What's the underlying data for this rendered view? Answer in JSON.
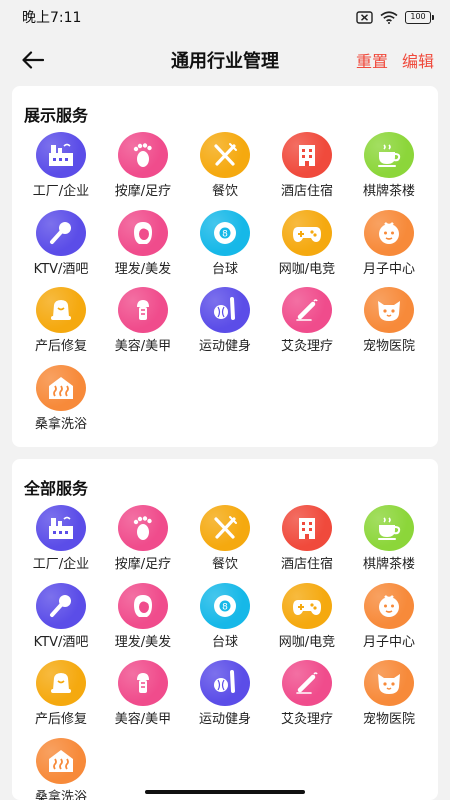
{
  "status_bar": {
    "time": "晚上7:11",
    "battery": "100"
  },
  "header": {
    "title": "通用行业管理",
    "reset_label": "重置",
    "edit_label": "编辑"
  },
  "sections": [
    {
      "title": "展示服务",
      "items": [
        {
          "label": "工厂/企业",
          "icon": "factory-icon",
          "color": "#5b4de8"
        },
        {
          "label": "按摩/足疗",
          "icon": "footprint-icon",
          "color": "#f04c8c"
        },
        {
          "label": "餐饮",
          "icon": "fork-knife-icon",
          "color": "#f5a90f"
        },
        {
          "label": "酒店住宿",
          "icon": "hotel-icon",
          "color": "#f04a3c"
        },
        {
          "label": "棋牌茶楼",
          "icon": "teacup-icon",
          "color": "#8cd63a"
        },
        {
          "label": "KTV/酒吧",
          "icon": "microphone-icon",
          "color": "#5b4de8"
        },
        {
          "label": "理发/美发",
          "icon": "hair-icon",
          "color": "#f04c8c"
        },
        {
          "label": "台球",
          "icon": "billiard-ball-icon",
          "color": "#16b8e8"
        },
        {
          "label": "网咖/电竞",
          "icon": "gamepad-icon",
          "color": "#f5a90f"
        },
        {
          "label": "月子中心",
          "icon": "baby-icon",
          "color": "#f78a3a"
        },
        {
          "label": "产后修复",
          "icon": "hat-icon",
          "color": "#f5a90f"
        },
        {
          "label": "美容/美甲",
          "icon": "nail-icon",
          "color": "#f04c8c"
        },
        {
          "label": "运动健身",
          "icon": "baseball-bat-icon",
          "color": "#5b4de8"
        },
        {
          "label": "艾灸理疗",
          "icon": "moxibustion-icon",
          "color": "#f04c8c"
        },
        {
          "label": "宠物医院",
          "icon": "cat-icon",
          "color": "#f78a3a"
        },
        {
          "label": "桑拿洗浴",
          "icon": "sauna-icon",
          "color": "#f78a3a"
        }
      ]
    },
    {
      "title": "全部服务",
      "items": [
        {
          "label": "工厂/企业",
          "icon": "factory-icon",
          "color": "#5b4de8"
        },
        {
          "label": "按摩/足疗",
          "icon": "footprint-icon",
          "color": "#f04c8c"
        },
        {
          "label": "餐饮",
          "icon": "fork-knife-icon",
          "color": "#f5a90f"
        },
        {
          "label": "酒店住宿",
          "icon": "hotel-icon",
          "color": "#f04a3c"
        },
        {
          "label": "棋牌茶楼",
          "icon": "teacup-icon",
          "color": "#8cd63a"
        },
        {
          "label": "KTV/酒吧",
          "icon": "microphone-icon",
          "color": "#5b4de8"
        },
        {
          "label": "理发/美发",
          "icon": "hair-icon",
          "color": "#f04c8c"
        },
        {
          "label": "台球",
          "icon": "billiard-ball-icon",
          "color": "#16b8e8"
        },
        {
          "label": "网咖/电竞",
          "icon": "gamepad-icon",
          "color": "#f5a90f"
        },
        {
          "label": "月子中心",
          "icon": "baby-icon",
          "color": "#f78a3a"
        },
        {
          "label": "产后修复",
          "icon": "hat-icon",
          "color": "#f5a90f"
        },
        {
          "label": "美容/美甲",
          "icon": "nail-icon",
          "color": "#f04c8c"
        },
        {
          "label": "运动健身",
          "icon": "baseball-bat-icon",
          "color": "#5b4de8"
        },
        {
          "label": "艾灸理疗",
          "icon": "moxibustion-icon",
          "color": "#f04c8c"
        },
        {
          "label": "宠物医院",
          "icon": "cat-icon",
          "color": "#f78a3a"
        },
        {
          "label": "桑拿洗浴",
          "icon": "sauna-icon",
          "color": "#f78a3a"
        }
      ]
    }
  ]
}
